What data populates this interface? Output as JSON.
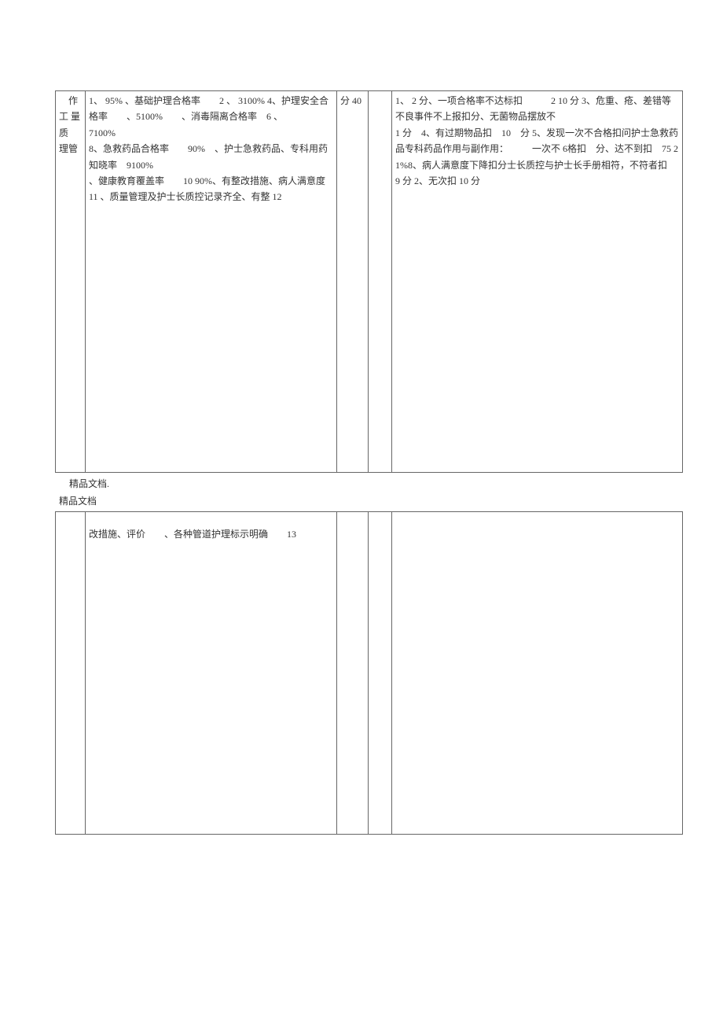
{
  "table1": {
    "col1": "　作工 量质　理管",
    "col2": "1、 95% 、基础护理合格率　　2 、 3100% 4、护理安全合格率　　、5100%　　、消毒隔离合格率　6 、\n7100%\n8、急救药品合格率　　90%　、护士急救药品、专科用药知晓率　9100%\n、健康教育覆盖率　　10 90%、有整改措施、病人满意度　11 、质量管理及护士长质控记录齐全、有整 12",
    "col3": "分 40",
    "col4": "",
    "col5": "1、 2 分、一项合格率不达标扣　　　2 10 分 3、危重、疮、差错等不良事件不上报扣分、无菌物品摆放不\n1 分　4、有过期物品扣　10　分 5、发现一次不合格扣问护士急救药品专科药品作用与副作用：　　　一次不 6格扣　分、达不到扣　75 21%8、病人满意度下降扣分士长质控与护士长手册相符，不符者扣　　　9 分 2、无次扣 10 分"
  },
  "footer1": "精品文档.",
  "header2": "精品文档",
  "table2": {
    "col1": "",
    "col2": "改措施、评价　　、各种管道护理标示明确　　13",
    "col3": "",
    "col4": "",
    "col5": ""
  }
}
